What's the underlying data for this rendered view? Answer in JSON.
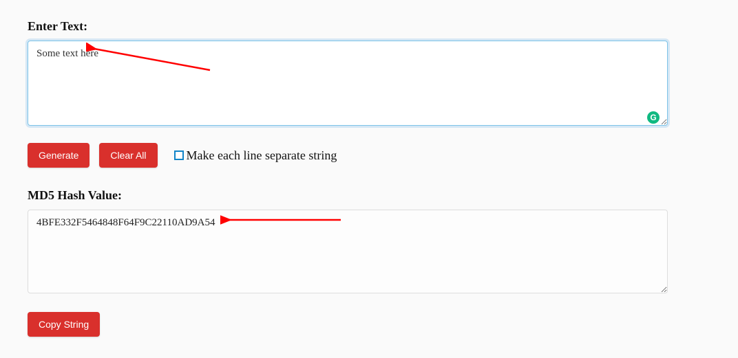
{
  "input": {
    "label": "Enter Text:",
    "value": "Some text here"
  },
  "buttons": {
    "generate": "Generate",
    "clearAll": "Clear All",
    "copyString": "Copy String"
  },
  "checkbox": {
    "label": "Make each line separate string"
  },
  "output": {
    "label": "MD5 Hash Value:",
    "value": "4BFE332F5464848F64F9C22110AD9A54"
  }
}
